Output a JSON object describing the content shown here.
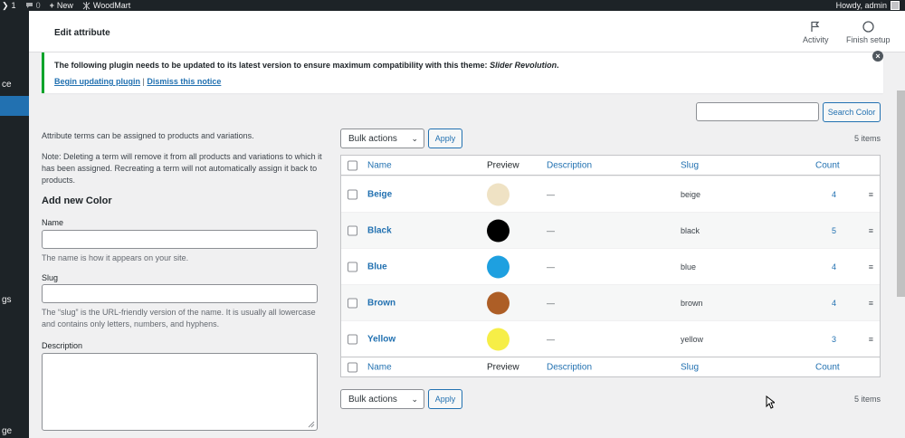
{
  "adminbar": {
    "updates_count": "1",
    "comments_count": "0",
    "new_label": "New",
    "site_name": "WoodMart",
    "greeting": "Howdy, admin"
  },
  "menu": {
    "visible_labels": [
      "ce",
      "gs",
      "ge"
    ]
  },
  "header": {
    "title": "Edit attribute",
    "activity_label": "Activity",
    "finish_setup_label": "Finish setup"
  },
  "notice": {
    "message": "The following plugin needs to be updated to its latest version to ensure maximum compatibility with this theme: ",
    "plugin_name": "Slider Revolution",
    "message_end": ".",
    "update_link": "Begin updating plugin",
    "separator": "|",
    "dismiss_link": "Dismiss this notice"
  },
  "search": {
    "value": "",
    "button_label": "Search Color"
  },
  "form": {
    "intro": "Attribute terms can be assigned to products and variations.",
    "note": "Note: Deleting a term will remove it from all products and variations to which it has been assigned. Recreating a term will not automatically assign it back to products.",
    "heading": "Add new Color",
    "name_label": "Name",
    "name_value": "",
    "name_help": "The name is how it appears on your site.",
    "slug_label": "Slug",
    "slug_value": "",
    "slug_help": "The “slug” is the URL-friendly version of the name. It is usually all lowercase and contains only letters, numbers, and hyphens.",
    "description_label": "Description",
    "description_value": ""
  },
  "table": {
    "bulk_actions": "Bulk actions",
    "apply_label": "Apply",
    "items_count": "5 items",
    "columns": {
      "name": "Name",
      "preview": "Preview",
      "description": "Description",
      "slug": "Slug",
      "count": "Count"
    },
    "rows": [
      {
        "name": "Beige",
        "color": "#efe2c4",
        "description": "—",
        "slug": "beige",
        "count": "4"
      },
      {
        "name": "Black",
        "color": "#000000",
        "description": "—",
        "slug": "black",
        "count": "5"
      },
      {
        "name": "Blue",
        "color": "#1ea0e0",
        "description": "—",
        "slug": "blue",
        "count": "4"
      },
      {
        "name": "Brown",
        "color": "#ad5e26",
        "description": "—",
        "slug": "brown",
        "count": "4"
      },
      {
        "name": "Yellow",
        "color": "#f6ee47",
        "description": "—",
        "slug": "yellow",
        "count": "3"
      }
    ]
  },
  "colors": {
    "accent": "#2271b1",
    "notice_border": "#00a32a",
    "admin_bar": "#1d2327"
  }
}
